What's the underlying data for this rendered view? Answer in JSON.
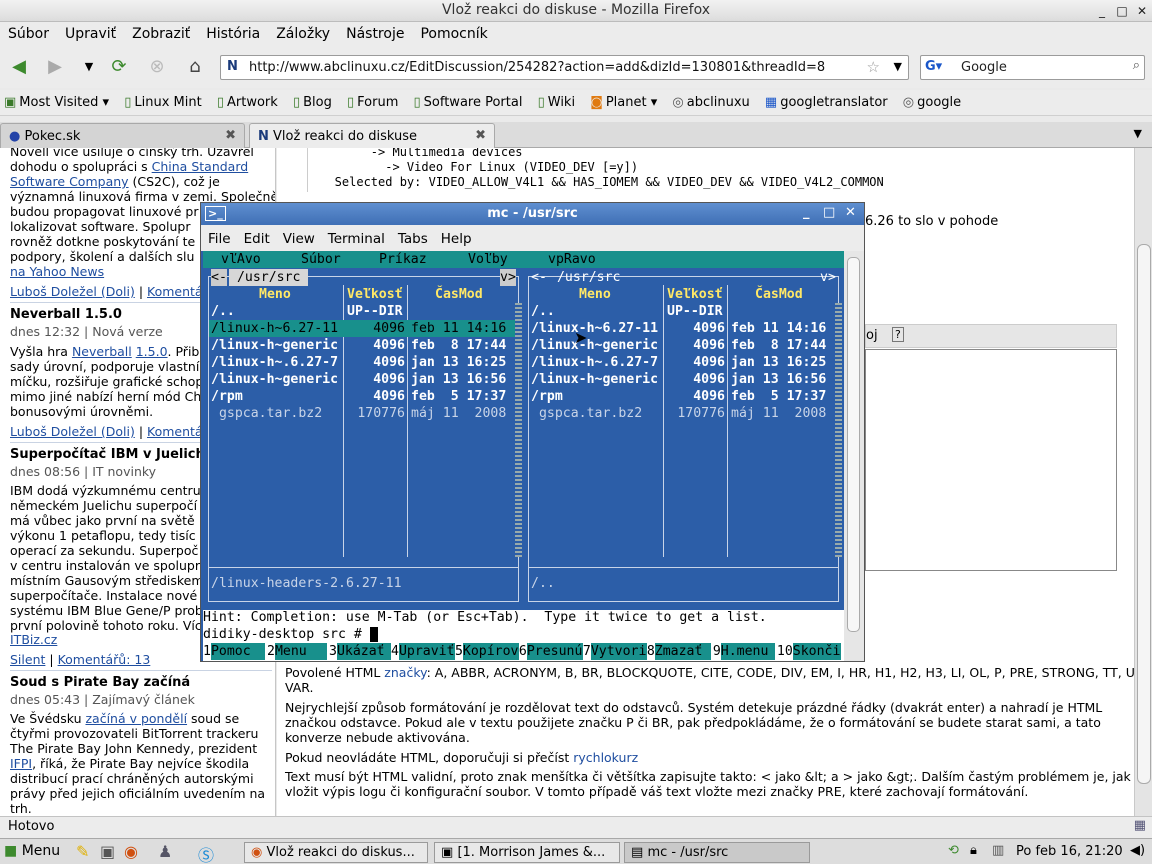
{
  "window": {
    "title": "Vlož reakci do diskuse - Mozilla Firefox"
  },
  "menu": [
    "Súbor",
    "Upraviť",
    "Zobraziť",
    "História",
    "Záložky",
    "Nástroje",
    "Pomocník"
  ],
  "nav": {
    "url": "http://www.abclinuxu.cz/EditDiscussion/254282?action=add&dizId=130801&threadId=8",
    "search_value": "Google"
  },
  "bookmarks": [
    "Most Visited ▾",
    "Linux Mint",
    "Artwork",
    "Blog",
    "Forum",
    "Software Portal",
    "Wiki",
    "Planet ▾",
    "abclinuxu",
    "googletranslator",
    "google"
  ],
  "tabs": [
    {
      "label": "Pokec.sk"
    },
    {
      "label": "Vlož reakci do diskuse"
    }
  ],
  "sidebar": {
    "l1": "Novell více usiluje o čínský trh. Uzavřel",
    "l2a": "dohodu o spolupráci s ",
    "l2b": "China Standard",
    "l3a": "Software Company",
    "l3b": " (CS2C), což je",
    "l4": "významná linuxová firma v zemi. Společně",
    "l5": "budou propagovat linuxové pr",
    "l6": "lokalizovat software. Spolupr",
    "l7": "rovněž dotkne poskytování te",
    "l8": "podpory, školení a dalších slu",
    "l9": "na Yahoo News",
    "a1": "Luboš Doležel (Doli)",
    "a1c": "Komentá",
    "h2": "Neverball 1.5.0",
    "d2": "dnes 12:32 | Nová verze",
    "b2l1a": "Vyšla hra ",
    "b2l1b": "Neverball",
    "b2l1c": "1.5.0",
    "b2l1d": ". Přib",
    "b2l2": "sady úrovní, podporuje vlastní",
    "b2l3": "míčku, rozšiřuje grafické schop",
    "b2l4": "mimo jiné nabízí herní mód Ch",
    "b2l5": "bonusovými úrovněmi.",
    "a2": "Luboš Doležel (Doli)",
    "a2c": "Komentá",
    "h3": "Superpočítač IBM v Juelichu",
    "d3": "dnes 08:56 | IT novinky",
    "b3": [
      "IBM dodá výzkumnému centru",
      "německém Juelichu superpočí",
      "má vůbec jako první na světě",
      "výkonu 1 petaflopu, tedy tisíc",
      "operací za sekundu. Superpoč",
      "v centru instalován ve spolupr",
      "místním Gausovým střediskem",
      "superpočítače. Instalace nové",
      "systému IBM Blue Gene/P prob",
      "první polovině tohoto roku. Víc"
    ],
    "b3src": "ITBiz.cz",
    "a3": "Silent",
    "a3c": "Komentářů: 13",
    "h4": "Soud s Pirate Bay začíná",
    "d4": "dnes 05:43 | Zajímavý článek",
    "b4l1a": "Ve Švédsku ",
    "b4l1b": "začíná v pondělí",
    "b4l1c": " soud se",
    "b4l2": "čtyřmi provozovateli BitTorrent trackeru",
    "b4l3": "The Pirate Bay John Kennedy, prezident",
    "b4l4a": "IFPI",
    "b4l4b": ", říká, že Pirate Bay nejvíce škodila",
    "b4l5": "distribucí prací chráněných autorskými",
    "b4l6": "právy před jejich oficiálním uvedením na",
    "b4l7": "trh."
  },
  "main": {
    "code1": "        -> Multimedia devices",
    "code2": "          -> Video For Linux (VIDEO_DEV [=y])",
    "code3": "   Selected by: VIDEO_ALLOW_V4L1 && HAS_IOMEM && VIDEO_DEV && VIDEO_V4L2_COMMON",
    "frag1": "6.26 to slo v pohode",
    "frag2": "oj",
    "allowed_a": "Povolené HTML ",
    "allowed_link": "značky",
    "allowed_b": ": A, ABBR, ACRONYM, B, BR, BLOCKQUOTE, CITE, CODE, DIV, EM, I, HR, H1, H2, H3, LI, OL, P, PRE, STRONG, TT, UL,",
    "allowed_c": "VAR.",
    "p1": "Nejrychlejší způsob formátování je rozdělovat text do odstavců. Systém detekuje prázdné řádky (dvakrát enter) a nahradí je HTML",
    "p1b": "značkou odstavce. Pokud ale v textu použijete značku P či BR, pak předpokládáme, že o formátování se budete starat sami, a tato",
    "p1c": "konverze nebude aktivována.",
    "p2a": "Pokud neovládáte HTML, doporučuji si přečíst ",
    "p2link": "rychlokurz",
    "p3": "Text musí být HTML validní, proto znak menšítka či většítka zapisujte takto: < jako &lt; a > jako &gt;. Dalším častým problémem je, jak",
    "p3b": "vložit výpis logu či konfigurační soubor. V tomto případě váš text vložte mezi značky PRE, které zachovají formátování."
  },
  "mc": {
    "title": "mc - /usr/src",
    "menu": [
      "File",
      "Edit",
      "View",
      "Terminal",
      "Tabs",
      "Help"
    ],
    "topmenu": [
      "vľAvo",
      "Súbor",
      "Príkaz",
      "Voľby",
      "vpRavo"
    ],
    "left_path": " /usr/src ",
    "right_path": " /usr/src ",
    "col_name": "Meno",
    "col_size": "Veľkosť",
    "col_time": "ČasMod",
    "rows": [
      {
        "name": "/..",
        "size": "UP--DIR",
        "time": ""
      },
      {
        "name": "/linux-h~6.27-11",
        "size": "4096",
        "time": "feb 11 14:16"
      },
      {
        "name": "/linux-h~generic",
        "size": "4096",
        "time": "feb  8 17:44"
      },
      {
        "name": "/linux-h~.6.27-7",
        "size": "4096",
        "time": "jan 13 16:25"
      },
      {
        "name": "/linux-h~generic",
        "size": "4096",
        "time": "jan 13 16:56"
      },
      {
        "name": "/rpm",
        "size": "4096",
        "time": "feb  5 17:37"
      },
      {
        "name": " gspca.tar.bz2",
        "size": "170776",
        "time": "máj 11  2008"
      }
    ],
    "left_status": "/linux-headers-2.6.27-11",
    "right_status": "/..",
    "hint": "Hint: Completion: use M-Tab (or Esc+Tab).  Type it twice to get a list.",
    "prompt": "didiky-desktop src # ",
    "fkeys": [
      {
        "n": "1",
        "l": "Pomoc"
      },
      {
        "n": "2",
        "l": "Menu"
      },
      {
        "n": "3",
        "l": "Ukázať"
      },
      {
        "n": "4",
        "l": "Upraviť"
      },
      {
        "n": "5",
        "l": "Kopírov"
      },
      {
        "n": "6",
        "l": "Presunú"
      },
      {
        "n": "7",
        "l": "Vytvori"
      },
      {
        "n": "8",
        "l": "Zmazať"
      },
      {
        "n": "9",
        "l": "H.menu"
      },
      {
        "n": "10",
        "l": "Skonči"
      }
    ]
  },
  "status": "Hotovo",
  "taskbar": {
    "menu": "Menu",
    "items": [
      "Vlož reakci do diskus...",
      "[1. Morrison James &...",
      "mc - /usr/src"
    ],
    "clock": "Po feb 16, 21:20"
  }
}
